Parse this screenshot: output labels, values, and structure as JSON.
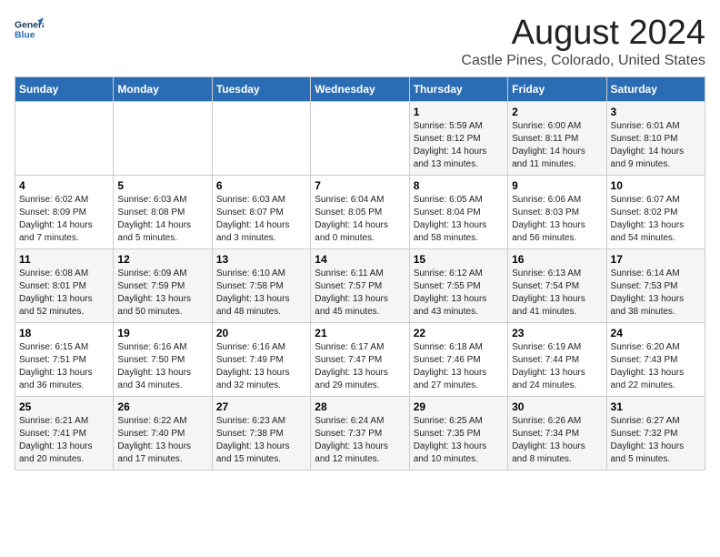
{
  "header": {
    "logo_line1": "General",
    "logo_line2": "Blue",
    "main_title": "August 2024",
    "subtitle": "Castle Pines, Colorado, United States"
  },
  "weekdays": [
    "Sunday",
    "Monday",
    "Tuesday",
    "Wednesday",
    "Thursday",
    "Friday",
    "Saturday"
  ],
  "weeks": [
    [
      {
        "day": "",
        "info": ""
      },
      {
        "day": "",
        "info": ""
      },
      {
        "day": "",
        "info": ""
      },
      {
        "day": "",
        "info": ""
      },
      {
        "day": "1",
        "info": "Sunrise: 5:59 AM\nSunset: 8:12 PM\nDaylight: 14 hours\nand 13 minutes."
      },
      {
        "day": "2",
        "info": "Sunrise: 6:00 AM\nSunset: 8:11 PM\nDaylight: 14 hours\nand 11 minutes."
      },
      {
        "day": "3",
        "info": "Sunrise: 6:01 AM\nSunset: 8:10 PM\nDaylight: 14 hours\nand 9 minutes."
      }
    ],
    [
      {
        "day": "4",
        "info": "Sunrise: 6:02 AM\nSunset: 8:09 PM\nDaylight: 14 hours\nand 7 minutes."
      },
      {
        "day": "5",
        "info": "Sunrise: 6:03 AM\nSunset: 8:08 PM\nDaylight: 14 hours\nand 5 minutes."
      },
      {
        "day": "6",
        "info": "Sunrise: 6:03 AM\nSunset: 8:07 PM\nDaylight: 14 hours\nand 3 minutes."
      },
      {
        "day": "7",
        "info": "Sunrise: 6:04 AM\nSunset: 8:05 PM\nDaylight: 14 hours\nand 0 minutes."
      },
      {
        "day": "8",
        "info": "Sunrise: 6:05 AM\nSunset: 8:04 PM\nDaylight: 13 hours\nand 58 minutes."
      },
      {
        "day": "9",
        "info": "Sunrise: 6:06 AM\nSunset: 8:03 PM\nDaylight: 13 hours\nand 56 minutes."
      },
      {
        "day": "10",
        "info": "Sunrise: 6:07 AM\nSunset: 8:02 PM\nDaylight: 13 hours\nand 54 minutes."
      }
    ],
    [
      {
        "day": "11",
        "info": "Sunrise: 6:08 AM\nSunset: 8:01 PM\nDaylight: 13 hours\nand 52 minutes."
      },
      {
        "day": "12",
        "info": "Sunrise: 6:09 AM\nSunset: 7:59 PM\nDaylight: 13 hours\nand 50 minutes."
      },
      {
        "day": "13",
        "info": "Sunrise: 6:10 AM\nSunset: 7:58 PM\nDaylight: 13 hours\nand 48 minutes."
      },
      {
        "day": "14",
        "info": "Sunrise: 6:11 AM\nSunset: 7:57 PM\nDaylight: 13 hours\nand 45 minutes."
      },
      {
        "day": "15",
        "info": "Sunrise: 6:12 AM\nSunset: 7:55 PM\nDaylight: 13 hours\nand 43 minutes."
      },
      {
        "day": "16",
        "info": "Sunrise: 6:13 AM\nSunset: 7:54 PM\nDaylight: 13 hours\nand 41 minutes."
      },
      {
        "day": "17",
        "info": "Sunrise: 6:14 AM\nSunset: 7:53 PM\nDaylight: 13 hours\nand 38 minutes."
      }
    ],
    [
      {
        "day": "18",
        "info": "Sunrise: 6:15 AM\nSunset: 7:51 PM\nDaylight: 13 hours\nand 36 minutes."
      },
      {
        "day": "19",
        "info": "Sunrise: 6:16 AM\nSunset: 7:50 PM\nDaylight: 13 hours\nand 34 minutes."
      },
      {
        "day": "20",
        "info": "Sunrise: 6:16 AM\nSunset: 7:49 PM\nDaylight: 13 hours\nand 32 minutes."
      },
      {
        "day": "21",
        "info": "Sunrise: 6:17 AM\nSunset: 7:47 PM\nDaylight: 13 hours\nand 29 minutes."
      },
      {
        "day": "22",
        "info": "Sunrise: 6:18 AM\nSunset: 7:46 PM\nDaylight: 13 hours\nand 27 minutes."
      },
      {
        "day": "23",
        "info": "Sunrise: 6:19 AM\nSunset: 7:44 PM\nDaylight: 13 hours\nand 24 minutes."
      },
      {
        "day": "24",
        "info": "Sunrise: 6:20 AM\nSunset: 7:43 PM\nDaylight: 13 hours\nand 22 minutes."
      }
    ],
    [
      {
        "day": "25",
        "info": "Sunrise: 6:21 AM\nSunset: 7:41 PM\nDaylight: 13 hours\nand 20 minutes."
      },
      {
        "day": "26",
        "info": "Sunrise: 6:22 AM\nSunset: 7:40 PM\nDaylight: 13 hours\nand 17 minutes."
      },
      {
        "day": "27",
        "info": "Sunrise: 6:23 AM\nSunset: 7:38 PM\nDaylight: 13 hours\nand 15 minutes."
      },
      {
        "day": "28",
        "info": "Sunrise: 6:24 AM\nSunset: 7:37 PM\nDaylight: 13 hours\nand 12 minutes."
      },
      {
        "day": "29",
        "info": "Sunrise: 6:25 AM\nSunset: 7:35 PM\nDaylight: 13 hours\nand 10 minutes."
      },
      {
        "day": "30",
        "info": "Sunrise: 6:26 AM\nSunset: 7:34 PM\nDaylight: 13 hours\nand 8 minutes."
      },
      {
        "day": "31",
        "info": "Sunrise: 6:27 AM\nSunset: 7:32 PM\nDaylight: 13 hours\nand 5 minutes."
      }
    ]
  ]
}
